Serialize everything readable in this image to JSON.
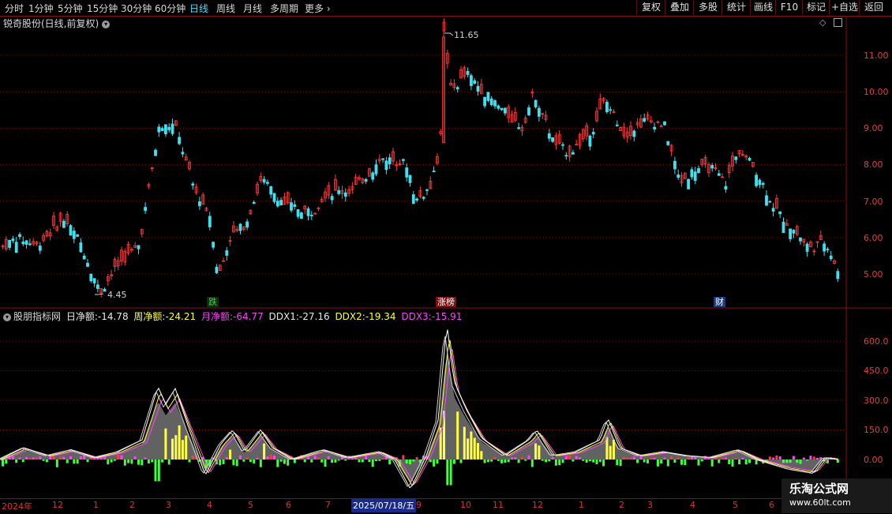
{
  "toolbar": {
    "periods": [
      "分时",
      "1分钟",
      "5分钟",
      "15分钟",
      "30分钟",
      "60分钟",
      "日线",
      "周线",
      "月线",
      "多周期",
      "更多"
    ],
    "active_period": "日线",
    "buttons": [
      "复权",
      "叠加",
      "多股",
      "统计",
      "画线",
      "F10",
      "标记",
      "+自选",
      "返回"
    ]
  },
  "main_chart": {
    "title": "锐奇股份(日线,前复权)",
    "high_label": "11.65",
    "low_label": "4.45",
    "y_ticks": [
      "11.00",
      "10.00",
      "9.00",
      "8.00",
      "7.00",
      "6.00",
      "5.00"
    ],
    "events": [
      {
        "text": "跌",
        "color": "#40d040",
        "bg": "#102a10"
      },
      {
        "text": "涨榜",
        "color": "#ffffff",
        "bg": "#7a1010"
      },
      {
        "text": "财",
        "color": "#ffffff",
        "bg": "#1a3a7a"
      }
    ]
  },
  "indicator": {
    "name": "股朋指标网",
    "items": [
      {
        "label": "日净额:",
        "value": "-14.78",
        "color": "#e8e8e8"
      },
      {
        "label": "周净额:",
        "value": "-24.21",
        "color": "#ffff40"
      },
      {
        "label": "月净额:",
        "value": "-64.77",
        "color": "#ff40ff"
      },
      {
        "label": "DDX1:",
        "value": "-27.16",
        "color": "#e8e8e8"
      },
      {
        "label": "DDX2:",
        "value": "-19.34",
        "color": "#ffff40"
      },
      {
        "label": "DDX3:",
        "value": "-15.91",
        "color": "#ff40ff"
      }
    ],
    "y_ticks": [
      "600.0",
      "450.0",
      "300.0",
      "150.0",
      "0.00"
    ]
  },
  "date_axis": {
    "labels": [
      "2024年",
      "12",
      "1",
      "2",
      "3",
      "4",
      "5",
      "6",
      "7",
      "9",
      "10",
      "11",
      "12",
      "1",
      "2",
      "3",
      "4",
      "5",
      "6"
    ],
    "highlight": "2025/07/18/五"
  },
  "watermark": {
    "name": "乐淘公式网",
    "url": "www.60lt.com"
  },
  "colors": {
    "up": "#ff3b3b",
    "down": "#40e0f0",
    "grid": "#7a0e0e",
    "white_line": "#ffffff",
    "yellow": "#ffff40",
    "magenta": "#ff40ff",
    "green": "#40ff40"
  }
}
